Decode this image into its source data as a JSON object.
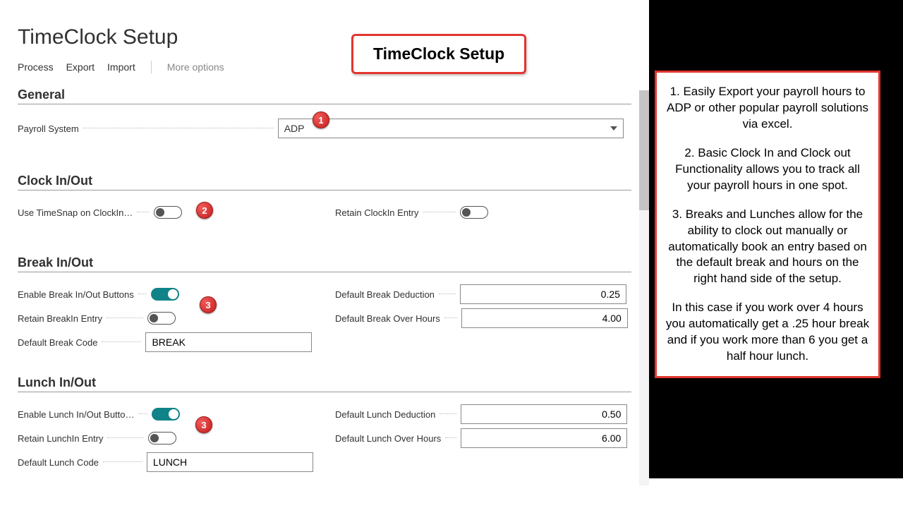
{
  "page": {
    "title": "TimeClock Setup"
  },
  "toolbar": {
    "process": "Process",
    "export": "Export",
    "import": "Import",
    "more": "More options"
  },
  "callout": {
    "title": "TimeClock Setup"
  },
  "badges": {
    "b1": "1",
    "b2": "2",
    "b3a": "3",
    "b3b": "3"
  },
  "sections": {
    "general": {
      "title": "General",
      "payroll_label": "Payroll System",
      "payroll_value": "ADP"
    },
    "clock": {
      "title": "Clock In/Out",
      "timesnap_label": "Use TimeSnap on ClockIn…",
      "retain_clockin_label": "Retain ClockIn Entry"
    },
    "breaks": {
      "title": "Break In/Out",
      "enable_label": "Enable Break In/Out Buttons",
      "retain_label": "Retain BreakIn Entry",
      "default_code_label": "Default Break Code",
      "default_code_value": "BREAK",
      "deduction_label": "Default Break Deduction",
      "deduction_value": "0.25",
      "over_label": "Default Break Over Hours",
      "over_value": "4.00"
    },
    "lunch": {
      "title": "Lunch In/Out",
      "enable_label": "Enable Lunch In/Out Butto…",
      "retain_label": "Retain LunchIn Entry",
      "default_code_label": "Default Lunch Code",
      "default_code_value": "LUNCH",
      "deduction_label": "Default Lunch Deduction",
      "deduction_value": "0.50",
      "over_label": "Default Lunch Over Hours",
      "over_value": "6.00"
    }
  },
  "info": {
    "p1": "1. Easily Export your payroll hours to ADP or other popular payroll solutions via excel.",
    "p2": "2. Basic Clock In and Clock out Functionality allows you to track all your payroll hours in one spot.",
    "p3": "3. Breaks and Lunches allow for the ability to clock out manually or automatically book an entry based on the default break and hours on the right hand side of the setup.",
    "p4": "In this case if you work over 4 hours you automatically get a .25 hour break and if you work more than 6 you get a half hour lunch."
  }
}
